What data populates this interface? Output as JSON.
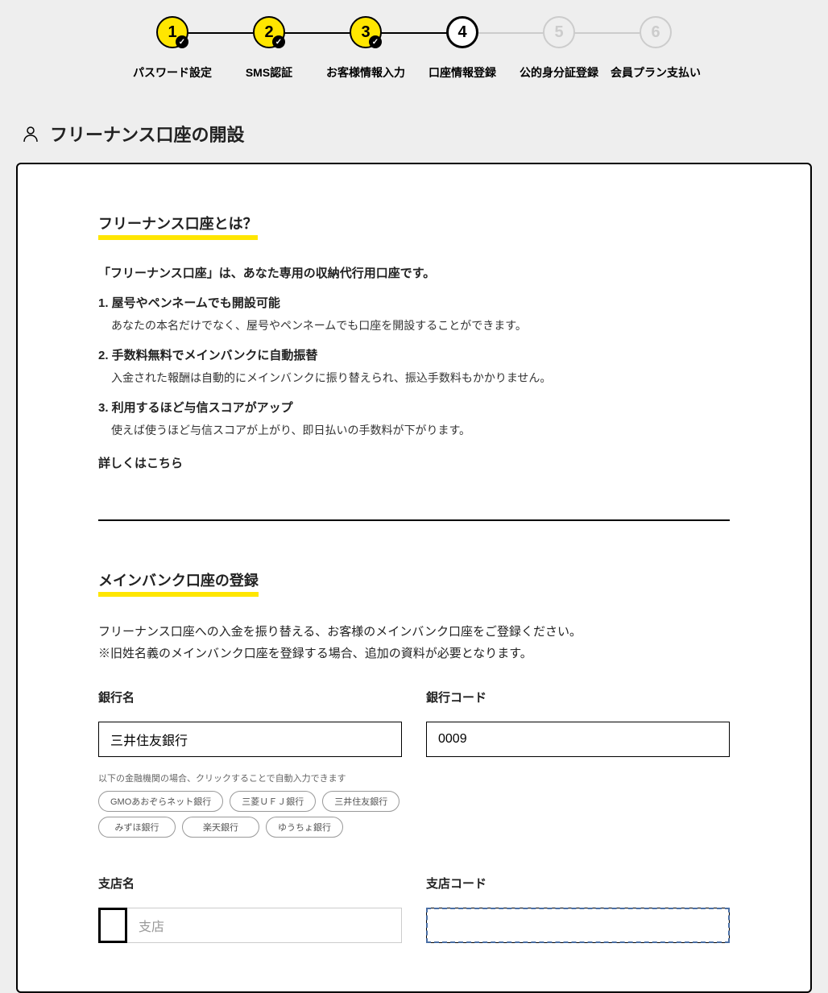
{
  "stepper": {
    "steps": [
      {
        "num": "1",
        "label": "パスワード設定",
        "state": "completed"
      },
      {
        "num": "2",
        "label": "SMS認証",
        "state": "completed"
      },
      {
        "num": "3",
        "label": "お客様情報入力",
        "state": "completed"
      },
      {
        "num": "4",
        "label": "口座情報登録",
        "state": "current"
      },
      {
        "num": "5",
        "label": "公的身分証登録",
        "state": "upcoming"
      },
      {
        "num": "6",
        "label": "会員プラン支払い",
        "state": "upcoming"
      }
    ]
  },
  "page_title": "フリーナンス口座の開設",
  "section1": {
    "heading": "フリーナンス口座とは？",
    "intro": "「フリーナンス口座」は、あなた専用の収納代行用口座です。",
    "benefits": [
      {
        "title": "1. 屋号やペンネームでも開設可能",
        "desc": "あなたの本名だけでなく、屋号やペンネームでも口座を開設することができます。"
      },
      {
        "title": "2. 手数料無料でメインバンクに自動振替",
        "desc": "入金された報酬は自動的にメインバンクに振り替えられ、振込手数料もかかりません。"
      },
      {
        "title": "3. 利用するほど与信スコアがアップ",
        "desc": "使えば使うほど与信スコアが上がり、即日払いの手数料が下がります。"
      }
    ],
    "details_link": "詳しくはこちら"
  },
  "section2": {
    "heading": "メインバンク口座の登録",
    "desc_line1": "フリーナンス口座への入金を振り替える、お客様のメインバンク口座をご登録ください。",
    "desc_line2": "※旧姓名義のメインバンク口座を登録する場合、追加の資料が必要となります。",
    "bank_name_label": "銀行名",
    "bank_name_value": "三井住友銀行",
    "bank_code_label": "銀行コード",
    "bank_code_value": "0009",
    "quick_fill_label": "以下の金融機関の場合、クリックすることで自動入力できます",
    "chips_row1": [
      "GMOあおぞらネット銀行",
      "三菱ＵＦＪ銀行",
      "三井住友銀行"
    ],
    "chips_row2": [
      "みずほ銀行",
      "楽天銀行",
      "ゆうちょ銀行"
    ],
    "branch_name_label": "支店名",
    "branch_name_value": "支店",
    "branch_code_label": "支店コード",
    "branch_code_value": ""
  }
}
